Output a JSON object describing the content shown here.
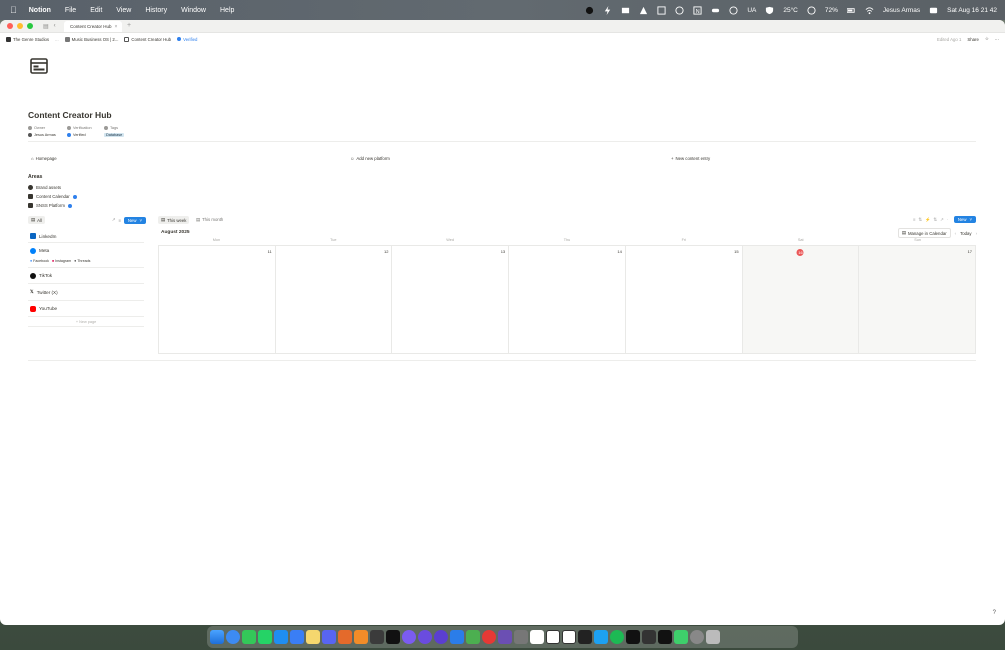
{
  "menubar": {
    "app_name": "Notion",
    "menus": [
      "File",
      "Edit",
      "View",
      "History",
      "Window",
      "Help"
    ],
    "status_text": {
      "lang": "UA",
      "weather": "25°C",
      "battery": "72%",
      "user": "Jesus Armas",
      "datetime": "Sat Aug 16  21 42"
    }
  },
  "browser": {
    "tab_title": "Content Creator Hub",
    "breadcrumbs": [
      "The Genre Studios",
      "...",
      "Music Business OS | 2...",
      "Content Creator Hub",
      "Verified"
    ],
    "edited": "Edited Ago 1",
    "share": "Share"
  },
  "page": {
    "title": "Content Creator Hub",
    "props": {
      "owner_label": "Owner",
      "verification_label": "Verification",
      "tags_label": "Tags",
      "owner_value": "Jesus Armas",
      "verification_value": "Verified",
      "tags_value": "Database"
    },
    "buttons": {
      "homepage": "Homepage",
      "add_platform": "Add new platform",
      "new_entry": "New content entry"
    },
    "areas": {
      "heading": "Areas",
      "items": [
        "Brand assets",
        "Content Calendar",
        "SNSS Platform"
      ]
    }
  },
  "list_view": {
    "tab": "All",
    "new_label": "New",
    "items": [
      {
        "label": "LinkedIn",
        "color": "#0a66c2"
      },
      {
        "label": "Meta",
        "color": "#0081fb"
      },
      {
        "label": "TikTok",
        "color": "#111111"
      },
      {
        "label": "Twitter (X)",
        "color": "#111111"
      },
      {
        "label": "YouTube",
        "color": "#ff0000"
      }
    ],
    "meta_sub": [
      "Facebook",
      "Instagram",
      "Threads"
    ],
    "new_page": "+ New page"
  },
  "calendar": {
    "views": [
      "This week",
      "This month"
    ],
    "new_label": "New",
    "month_title": "August 2025",
    "manage": "Manage in Calendar",
    "today": "Today",
    "weekdays": [
      "Mon",
      "Tue",
      "Wed",
      "Thu",
      "Fri",
      "Sat",
      "Sun"
    ],
    "days": [
      "11",
      "12",
      "13",
      "14",
      "15",
      "16",
      "17"
    ]
  }
}
